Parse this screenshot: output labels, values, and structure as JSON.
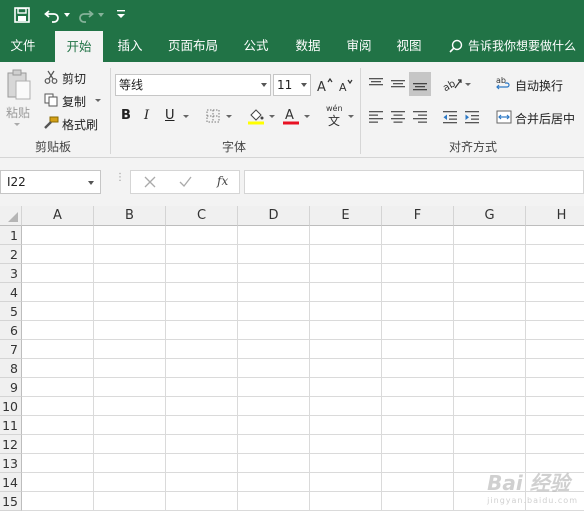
{
  "colors": {
    "brand": "#217346",
    "ribbon_bg": "#f3f3f3",
    "font_color_bar": "#e81123",
    "fill_color_bar": "#ffff00"
  },
  "menus": [
    "文件",
    "开始",
    "插入",
    "页面布局",
    "公式",
    "数据",
    "审阅",
    "视图"
  ],
  "tell_me": "告诉我你想要做什么",
  "clipboard": {
    "paste": "粘贴",
    "cut": "剪切",
    "copy": "复制",
    "format_painter": "格式刷",
    "group": "剪贴板"
  },
  "font": {
    "name": "等线",
    "size": "11",
    "group": "字体",
    "bold": "B",
    "italic": "I",
    "underline": "U",
    "phonetic": "wén",
    "phonetic_char": "文"
  },
  "alignment": {
    "wrap": "自动换行",
    "merge": "合并后居中",
    "group": "对齐方式"
  },
  "formula": {
    "cell_ref": "I22",
    "fx": "fx",
    "value": ""
  },
  "columns": [
    "A",
    "B",
    "C",
    "D",
    "E",
    "F",
    "G",
    "H"
  ],
  "rows": [
    "1",
    "2",
    "3",
    "4",
    "5",
    "6",
    "7",
    "8",
    "9",
    "10",
    "11",
    "12",
    "13",
    "14",
    "15"
  ],
  "watermark": {
    "text": "Bai 经验",
    "sub": "jingyan.baidu.com"
  }
}
